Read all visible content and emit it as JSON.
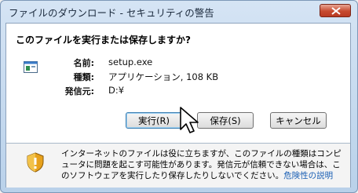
{
  "window": {
    "title": "ファイルのダウンロード - セキュリティの警告"
  },
  "dialog": {
    "question": "このファイルを実行または保存しますか?",
    "file": {
      "name_label": "名前:",
      "name": "setup.exe",
      "type_label": "種類:",
      "type": "アプリケーション, 108 KB",
      "from_label": "発信元:",
      "from": "D:¥"
    },
    "buttons": {
      "run": "実行(R)",
      "save": "保存(S)",
      "cancel": "キャンセル"
    },
    "warning": {
      "text": "インターネットのファイルは役に立ちますが、このファイルの種類はコンピュータに問題を起こす可能性があります。発信元が信頼できない場合は、このソフトウェアを実行したり保存したりしないでください。",
      "link": "危険性の説明"
    }
  },
  "icons": {
    "close": "close-icon",
    "file": "application-file-icon",
    "warning": "security-shield-icon",
    "cursor": "mouse-pointer-icon"
  }
}
